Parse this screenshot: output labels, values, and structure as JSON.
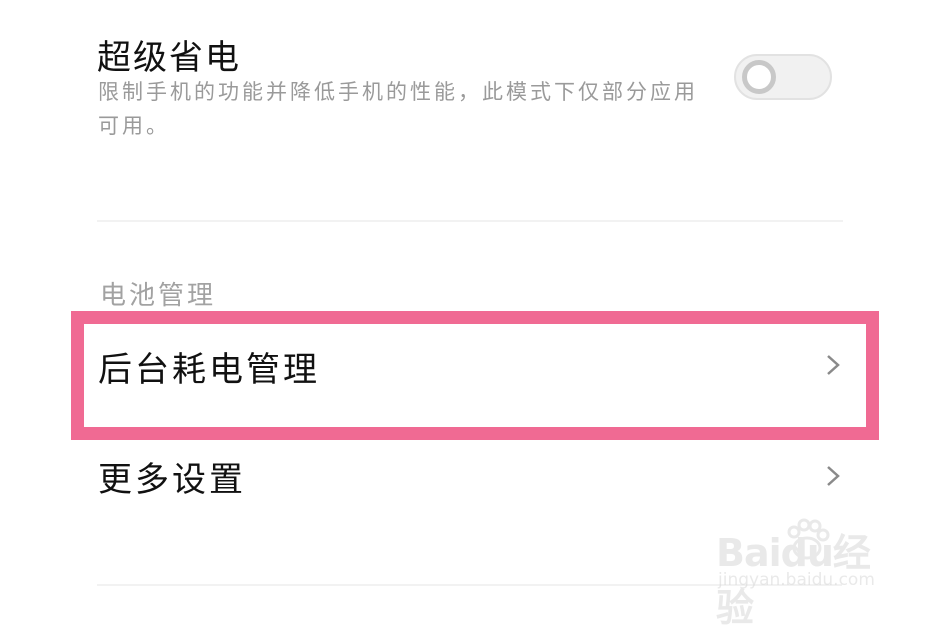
{
  "super_saver": {
    "title": "超级省电",
    "description": "限制手机的功能并降低手机的性能，此模式下仅部分应用可用。",
    "toggle_on": false
  },
  "battery_section": {
    "label": "电池管理",
    "items": [
      {
        "label": "后台耗电管理",
        "icon": "chevron-right-icon",
        "highlighted": true
      },
      {
        "label": "更多设置",
        "icon": "chevron-right-icon",
        "highlighted": false
      }
    ]
  },
  "colors": {
    "highlight": "#f06a93",
    "toggle_off": "#c8c8c8"
  },
  "watermark": {
    "logo_text": "Baidu经验",
    "url": "jingyan.baidu.com"
  }
}
